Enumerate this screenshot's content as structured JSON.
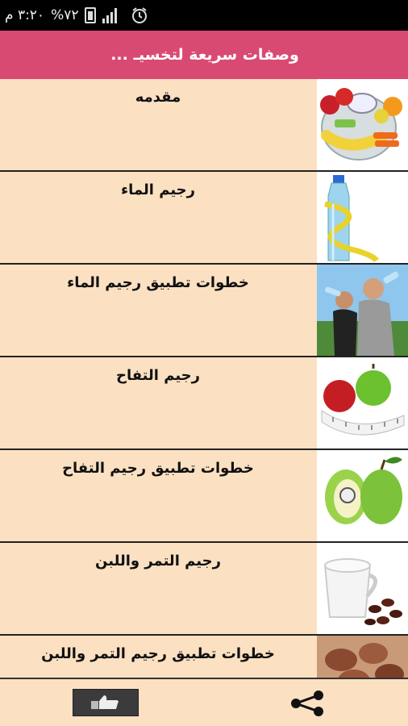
{
  "status_bar": {
    "time": "٣:٢٠ م",
    "battery": "%٧٢",
    "icons": [
      "signal-icon",
      "battery-icon",
      "alarm-icon"
    ]
  },
  "header": {
    "title": "وصفات سريعة لتخسيـ ..."
  },
  "list": {
    "items": [
      {
        "label": "مقدمه",
        "icon": "scale-fruit-image"
      },
      {
        "label": "رجيم الماء",
        "icon": "water-bottle-image"
      },
      {
        "label": "خطوات تطبيق رجيم الماء",
        "icon": "people-drinking-image"
      },
      {
        "label": "رجيم التفاح",
        "icon": "apples-tape-image"
      },
      {
        "label": "خطوات تطبيق رجيم التفاح",
        "icon": "green-apples-image"
      },
      {
        "label": "رجيم التمر واللبن",
        "icon": "milk-dates-image"
      },
      {
        "label": "خطوات تطبيق رجيم التمر واللبن",
        "icon": "dates-image"
      }
    ]
  },
  "bottom_bar": {
    "like_icon": "thumbs-up-icon",
    "share_icon": "share-icon"
  },
  "colors": {
    "header_bg": "#d94a72",
    "list_bg": "#fbe0c2",
    "status_bg": "#000000"
  }
}
